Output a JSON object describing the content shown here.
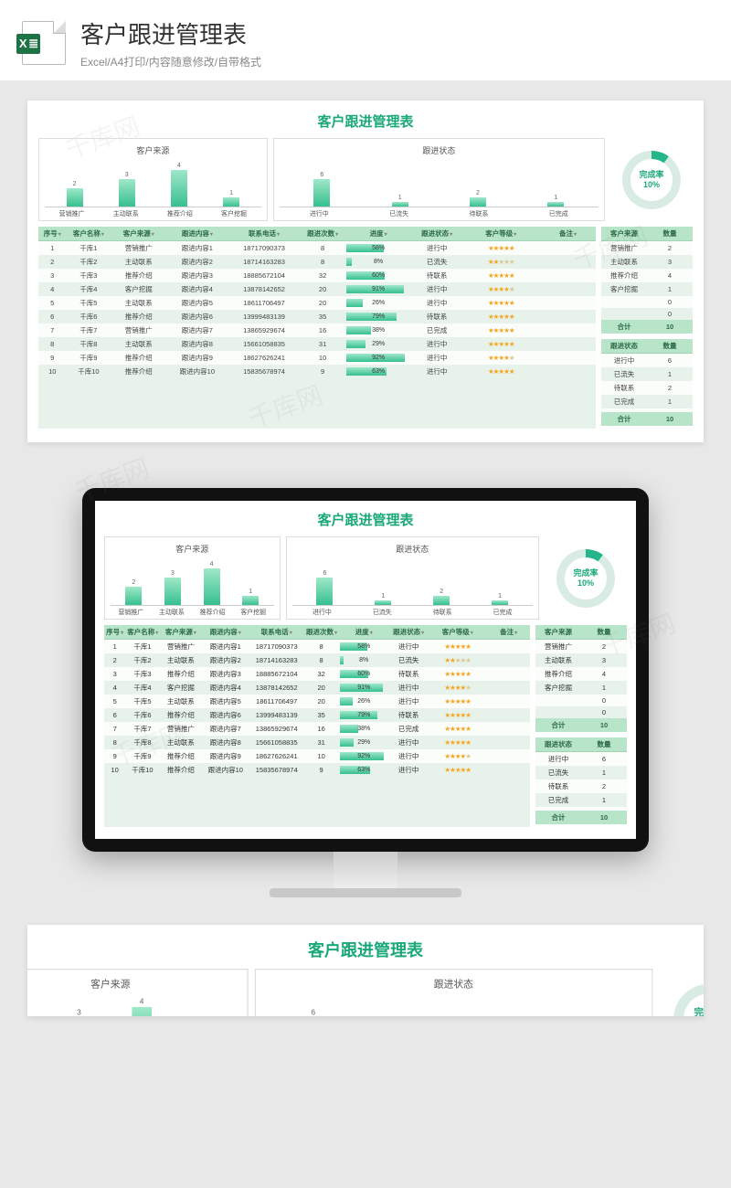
{
  "header": {
    "badge": "X ≣",
    "title": "客户跟进管理表",
    "subtitle": "Excel/A4打印/内容随意修改/自带格式"
  },
  "watermark": "千库网",
  "sheet": {
    "title": "客户跟进管理表",
    "donut": {
      "label": "完成率",
      "value": "10%"
    },
    "columns": [
      "序号",
      "客户名称",
      "客户来源",
      "跟进内容",
      "联系电话",
      "跟进次数",
      "进度",
      "跟进状态",
      "客户等级",
      "备注"
    ],
    "rows": [
      {
        "n": 1,
        "name": "千库1",
        "src": "营销推广",
        "content": "跟进内容1",
        "tel": "18717090373",
        "cnt": 8,
        "pct": 58,
        "status": "进行中",
        "stars": 5
      },
      {
        "n": 2,
        "name": "千库2",
        "src": "主动联系",
        "content": "跟进内容2",
        "tel": "18714163283",
        "cnt": 8,
        "pct": 8,
        "status": "已流失",
        "stars": 2
      },
      {
        "n": 3,
        "name": "千库3",
        "src": "推荐介绍",
        "content": "跟进内容3",
        "tel": "18885672104",
        "cnt": 32,
        "pct": 60,
        "status": "待联系",
        "stars": 5
      },
      {
        "n": 4,
        "name": "千库4",
        "src": "客户挖掘",
        "content": "跟进内容4",
        "tel": "13878142652",
        "cnt": 20,
        "pct": 91,
        "status": "进行中",
        "stars": 4
      },
      {
        "n": 5,
        "name": "千库5",
        "src": "主动联系",
        "content": "跟进内容5",
        "tel": "18611706497",
        "cnt": 20,
        "pct": 26,
        "status": "进行中",
        "stars": 5
      },
      {
        "n": 6,
        "name": "千库6",
        "src": "推荐介绍",
        "content": "跟进内容6",
        "tel": "13999483139",
        "cnt": 35,
        "pct": 79,
        "status": "待联系",
        "stars": 5
      },
      {
        "n": 7,
        "name": "千库7",
        "src": "营销推广",
        "content": "跟进内容7",
        "tel": "13865929674",
        "cnt": 16,
        "pct": 38,
        "status": "已完成",
        "stars": 5
      },
      {
        "n": 8,
        "name": "千库8",
        "src": "主动联系",
        "content": "跟进内容8",
        "tel": "15661058835",
        "cnt": 31,
        "pct": 29,
        "status": "进行中",
        "stars": 5
      },
      {
        "n": 9,
        "name": "千库9",
        "src": "推荐介绍",
        "content": "跟进内容9",
        "tel": "18627626241",
        "cnt": 10,
        "pct": 92,
        "status": "进行中",
        "stars": 4
      },
      {
        "n": 10,
        "name": "千库10",
        "src": "推荐介绍",
        "content": "跟进内容10",
        "tel": "15835678974",
        "cnt": 9,
        "pct": 63,
        "status": "进行中",
        "stars": 5
      }
    ],
    "sideA": {
      "head": [
        "客户来源",
        "数量"
      ],
      "rows": [
        [
          "营销推广",
          2
        ],
        [
          "主动联系",
          3
        ],
        [
          "推荐介绍",
          4
        ],
        [
          "客户挖掘",
          1
        ],
        [
          "",
          0
        ],
        [
          "",
          0
        ]
      ],
      "total": [
        "合计",
        10
      ]
    },
    "sideB": {
      "head": [
        "跟进状态",
        "数量"
      ],
      "rows": [
        [
          "进行中",
          6
        ],
        [
          "已流失",
          1
        ],
        [
          "待联系",
          2
        ],
        [
          "已完成",
          1
        ],
        [
          "",
          ""
        ]
      ],
      "total": [
        "合计",
        10
      ]
    }
  },
  "chart_data": [
    {
      "type": "bar",
      "title": "客户来源",
      "categories": [
        "营销推广",
        "主动联系",
        "推荐介绍",
        "客户挖掘"
      ],
      "values": [
        2,
        3,
        4,
        1
      ],
      "ylim": [
        0,
        5
      ]
    },
    {
      "type": "bar",
      "title": "跟进状态",
      "categories": [
        "进行中",
        "已流失",
        "待联系",
        "已完成"
      ],
      "values": [
        6,
        1,
        2,
        1
      ],
      "ylim": [
        0,
        10
      ]
    },
    {
      "type": "pie",
      "title": "完成率",
      "values": [
        10,
        90
      ],
      "labels": [
        "完成",
        "未完成"
      ]
    }
  ]
}
